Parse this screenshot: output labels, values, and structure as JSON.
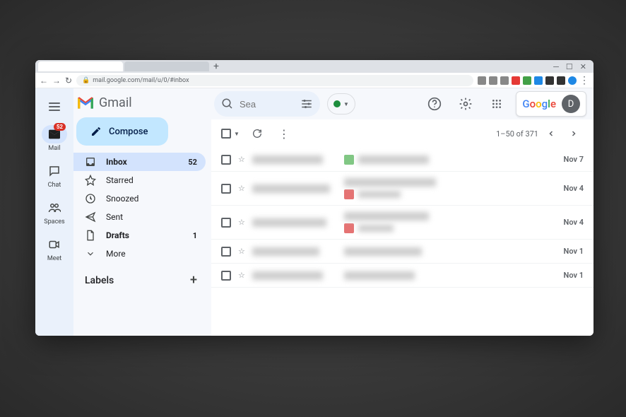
{
  "browser": {
    "url": "mail.google.com/mail/u/0/#inbox",
    "new_tab": "+"
  },
  "rail": {
    "mail": "Mail",
    "mail_badge": "52",
    "chat": "Chat",
    "spaces": "Spaces",
    "meet": "Meet"
  },
  "logo": "Gmail",
  "compose": "Compose",
  "nav": {
    "inbox": {
      "label": "Inbox",
      "count": "52"
    },
    "starred": {
      "label": "Starred"
    },
    "snoozed": {
      "label": "Snoozed"
    },
    "sent": {
      "label": "Sent"
    },
    "drafts": {
      "label": "Drafts",
      "count": "1"
    },
    "more": {
      "label": "More"
    }
  },
  "labels_header": "Labels",
  "search": {
    "placeholder": "Sea"
  },
  "google_logo": "Google",
  "avatar_letter": "D",
  "pager": {
    "range": "1–50 of 371"
  },
  "mails": [
    {
      "date": "Nov 7",
      "chip_color": "#81c784"
    },
    {
      "date": "Nov 4",
      "chip_color": "#e57373"
    },
    {
      "date": "Nov 4",
      "chip_color": "#e57373"
    },
    {
      "date": "Nov 1"
    },
    {
      "date": "Nov 1"
    }
  ]
}
